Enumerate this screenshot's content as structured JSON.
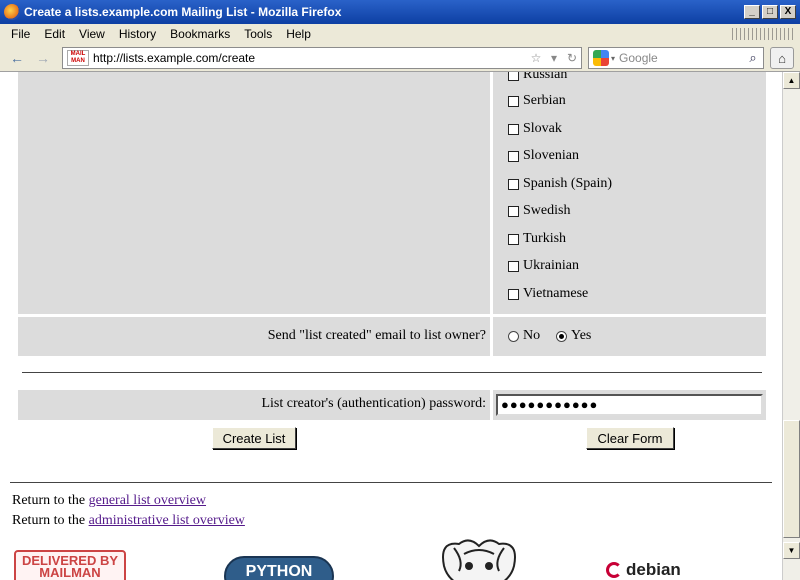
{
  "window": {
    "title": "Create a lists.example.com Mailing List - Mozilla Firefox",
    "controls": {
      "minimize": "_",
      "maximize": "□",
      "close": "X"
    }
  },
  "menu": [
    {
      "label": "File"
    },
    {
      "label": "Edit"
    },
    {
      "label": "View"
    },
    {
      "label": "History"
    },
    {
      "label": "Bookmarks"
    },
    {
      "label": "Tools"
    },
    {
      "label": "Help"
    }
  ],
  "nav": {
    "url": "http://lists.example.com/create",
    "site_icon": "MAIL MAN",
    "search_placeholder": "Google",
    "icons": {
      "back": "←",
      "forward": "→",
      "star": "☆",
      "dropdown": "▾",
      "reload": "↻",
      "search": "⌕",
      "home": "⌂"
    }
  },
  "languages": [
    {
      "label": "Russian",
      "checked": false
    },
    {
      "label": "Serbian",
      "checked": false
    },
    {
      "label": "Slovak",
      "checked": false
    },
    {
      "label": "Slovenian",
      "checked": false
    },
    {
      "label": "Spanish (Spain)",
      "checked": false
    },
    {
      "label": "Swedish",
      "checked": false
    },
    {
      "label": "Turkish",
      "checked": false
    },
    {
      "label": "Ukrainian",
      "checked": false
    },
    {
      "label": "Vietnamese",
      "checked": false
    }
  ],
  "notify": {
    "label": "Send \"list created\" email to list owner?",
    "no_label": "No",
    "yes_label": "Yes",
    "selected": "Yes"
  },
  "auth": {
    "label": "List creator's (authentication) password:",
    "value": "●●●●●●●●●●●"
  },
  "buttons": {
    "create": "Create List",
    "clear": "Clear Form"
  },
  "footer": {
    "links": [
      {
        "prefix": "Return to the ",
        "text": "general list overview"
      },
      {
        "prefix": "Return to the ",
        "text": "administrative list overview"
      }
    ],
    "logos": {
      "mailman": "DELIVERED BY MAILMAN",
      "python": "PYTHON",
      "debian": "debian"
    }
  }
}
